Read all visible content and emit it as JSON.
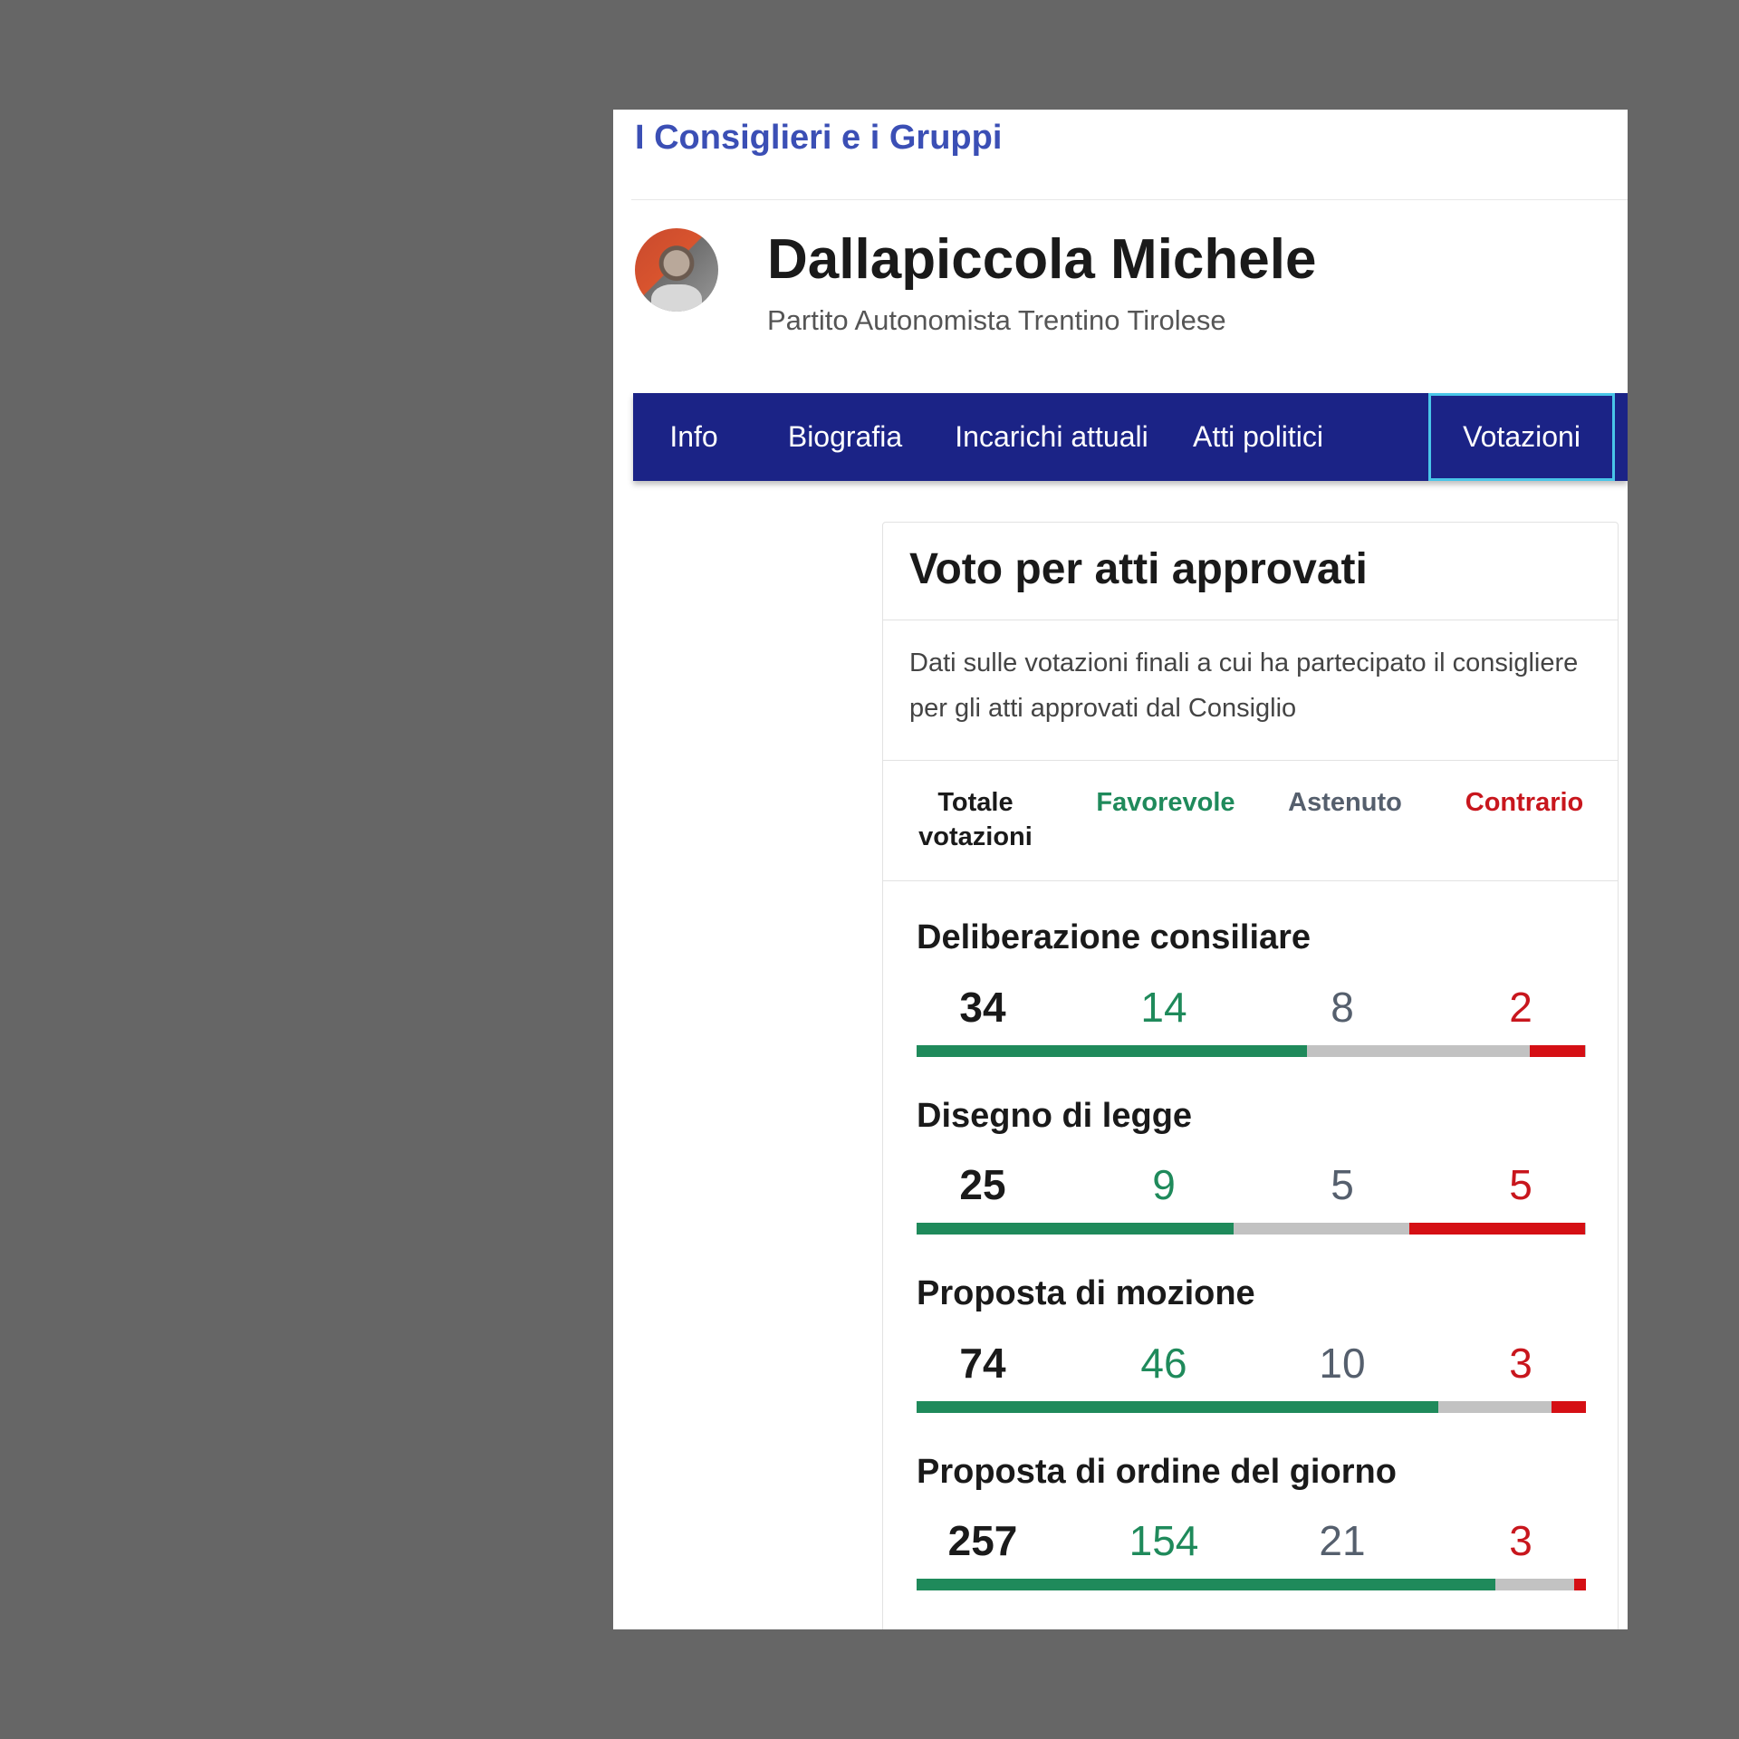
{
  "breadcrumb_title": "I Consiglieri e i Gruppi",
  "profile": {
    "name": "Dallapiccola Michele",
    "party": "Partito Autonomista Trentino Tirolese"
  },
  "tabs": [
    {
      "label": "Info",
      "active": false
    },
    {
      "label": "Biografia",
      "active": false
    },
    {
      "label": "Incarichi attuali",
      "active": false
    },
    {
      "label": "Atti politici",
      "active": false
    },
    {
      "label": "Votazioni",
      "active": true
    }
  ],
  "card": {
    "title": "Voto per atti approvati",
    "description": "Dati sulle votazioni finali a cui ha partecipato il consigliere per gli atti approvati dal Consiglio",
    "headers": {
      "total": "Totale votazioni",
      "favorevole": "Favorevole",
      "astenuto": "Astenuto",
      "contrario": "Contrario"
    },
    "categories": [
      {
        "title": "Deliberazione consiliare",
        "total": "34",
        "favorevole": "14",
        "astenuto": "8",
        "contrario": "2",
        "bar": {
          "favorevole": 0.583,
          "astenuto": 0.333,
          "contrario": 0.083
        }
      },
      {
        "title": "Disegno di legge",
        "total": "25",
        "favorevole": "9",
        "astenuto": "5",
        "contrario": "5",
        "bar": {
          "favorevole": 0.474,
          "astenuto": 0.263,
          "contrario": 0.263
        }
      },
      {
        "title": "Proposta di mozione",
        "total": "74",
        "favorevole": "46",
        "astenuto": "10",
        "contrario": "3",
        "bar": {
          "favorevole": 0.78,
          "astenuto": 0.169,
          "contrario": 0.051
        }
      },
      {
        "title": "Proposta di ordine del giorno",
        "total": "257",
        "favorevole": "154",
        "astenuto": "21",
        "contrario": "3",
        "bar": {
          "favorevole": 0.865,
          "astenuto": 0.118,
          "contrario": 0.017
        }
      }
    ]
  },
  "colors": {
    "favorevole": "#1f8a5b",
    "astenuto": "#c2c2c2",
    "contrario": "#d50f14",
    "nav": "#1b2386",
    "link": "#3b4fb5"
  }
}
